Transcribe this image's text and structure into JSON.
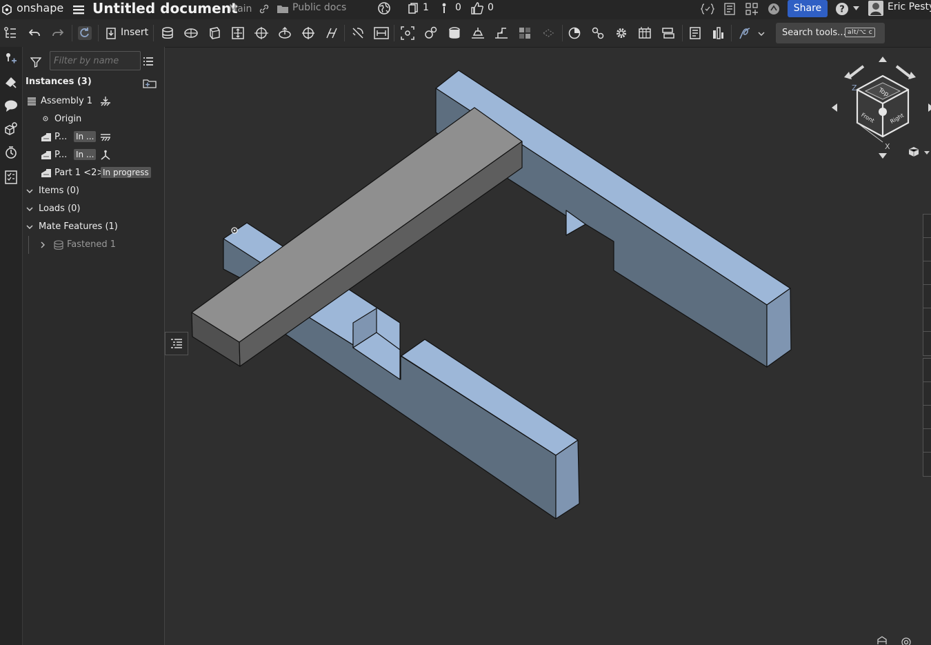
{
  "app": {
    "brand": "onshape",
    "doc_title": "Untitled document",
    "branch": "Main",
    "folder": "Public docs",
    "versions_count": "1",
    "comments_count": "0",
    "likes_count": "0",
    "share_label": "Share",
    "user_name": "Eric Pesty"
  },
  "toolbar": {
    "insert_label": "Insert",
    "search_label": "Search tools...",
    "search_shortcut": "alt/⌥ c"
  },
  "panel": {
    "filter_placeholder": "Filter by name",
    "instances_label": "Instances (3)",
    "assembly_label": "Assembly 1",
    "origin_label": "Origin",
    "part_a_label": "P...",
    "part_a_status": "In ...",
    "part_b_label": "P...",
    "part_b_status": "In ...",
    "part_c_label": "Part 1 <2>",
    "part_c_status": "In progress",
    "items_label": "Items (0)",
    "loads_label": "Loads (0)",
    "mate_features_label": "Mate Features (1)",
    "fastened_label": "Fastened 1"
  },
  "viewcube": {
    "top": "Top",
    "front": "Front",
    "right": "Right",
    "axis_z": "Z",
    "axis_x": "X"
  },
  "colors": {
    "accent": "#2f5fc4",
    "part_blue": "#9db7d8",
    "part_grey": "#8f8f8f",
    "badge_bg": "#555555"
  }
}
